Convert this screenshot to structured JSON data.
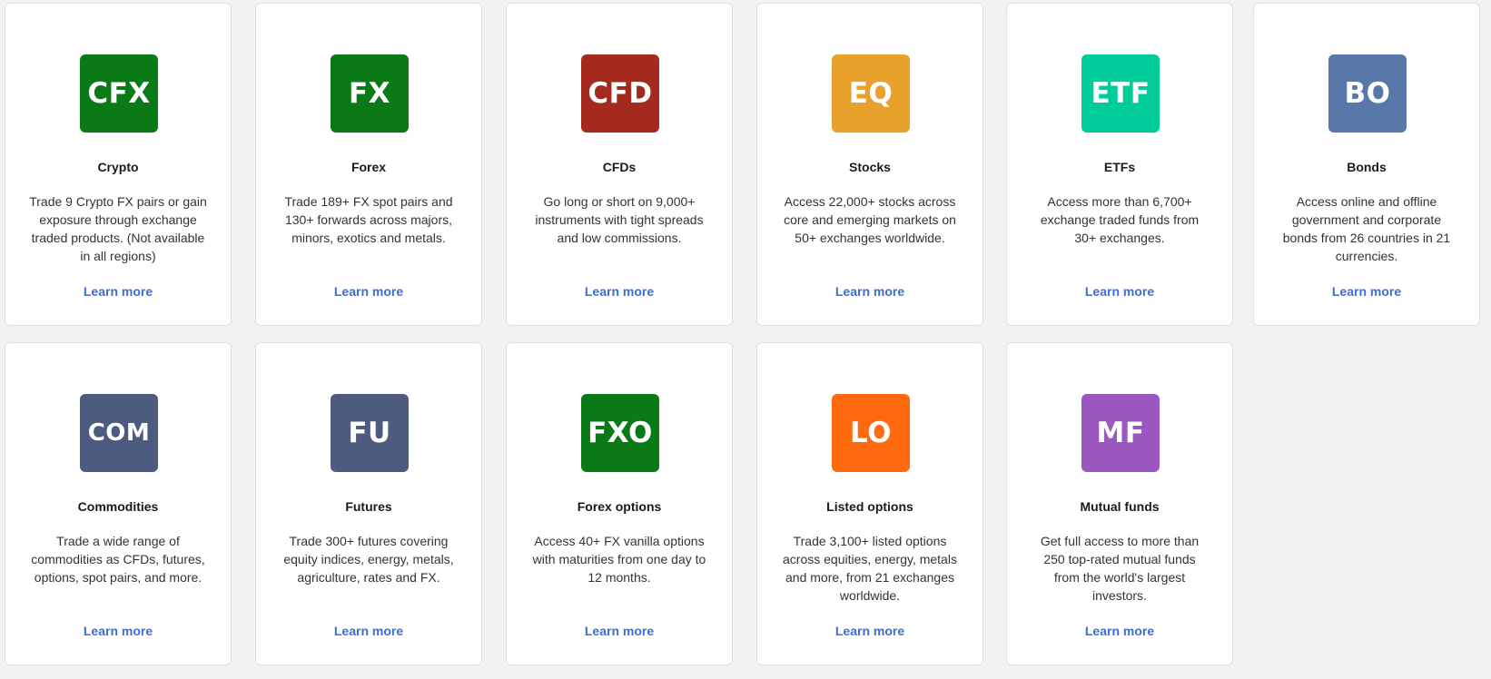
{
  "colors": {
    "link": "#3b6ed6",
    "background": "#f1f2f4"
  },
  "cards": [
    {
      "badge": "CFX",
      "badge_color": "#0a7a16",
      "title": "Crypto",
      "desc": "Trade 9 Crypto FX pairs or gain exposure through exchange traded products. (Not available in all regions)",
      "link": "Learn more"
    },
    {
      "badge": "FX",
      "badge_color": "#0a7a16",
      "title": "Forex",
      "desc": "Trade 189+ FX spot pairs and 130+ forwards across majors, minors, exotics and metals.",
      "link": "Learn more"
    },
    {
      "badge": "CFD",
      "badge_color": "#a42a1e",
      "title": "CFDs",
      "desc": "Go long or short on 9,000+ instruments with tight spreads and low commissions.",
      "link": "Learn more"
    },
    {
      "badge": "EQ",
      "badge_color": "#e8a22b",
      "title": "Stocks",
      "desc": "Access 22,000+ stocks across core and emerging markets on 50+ exchanges worldwide.",
      "link": "Learn more"
    },
    {
      "badge": "ETF",
      "badge_color": "#00cc99",
      "title": "ETFs",
      "desc": "Access more than 6,700+ exchange traded funds from 30+ exchanges.",
      "link": "Learn more"
    },
    {
      "badge": "BO",
      "badge_color": "#5878a9",
      "title": "Bonds",
      "desc": "Access online and offline government and corporate bonds from 26 countries in 21 currencies.",
      "link": "Learn more"
    },
    {
      "badge": "COM",
      "badge_color": "#4e5b81",
      "title": "Commodities",
      "desc": "Trade a wide range of commodities as CFDs, futures, options, spot pairs, and more.",
      "link": "Learn more"
    },
    {
      "badge": "FU",
      "badge_color": "#4e5b81",
      "title": "Futures",
      "desc": "Trade 300+ futures covering equity indices, energy, metals, agriculture, rates and FX.",
      "link": "Learn more"
    },
    {
      "badge": "FXO",
      "badge_color": "#0a7a16",
      "title": "Forex options",
      "desc": "Access 40+ FX vanilla options with maturities from one day to 12 months.",
      "link": "Learn more"
    },
    {
      "badge": "LO",
      "badge_color": "#ff6a0e",
      "title": "Listed options",
      "desc": "Trade 3,100+ listed options across equities, energy, metals and more, from 21 exchanges worldwide.",
      "link": "Learn more"
    },
    {
      "badge": "MF",
      "badge_color": "#9b56bf",
      "title": "Mutual funds",
      "desc": "Get full access to more than 250 top-rated mutual funds from the world's largest investors.",
      "link": "Learn more"
    }
  ]
}
